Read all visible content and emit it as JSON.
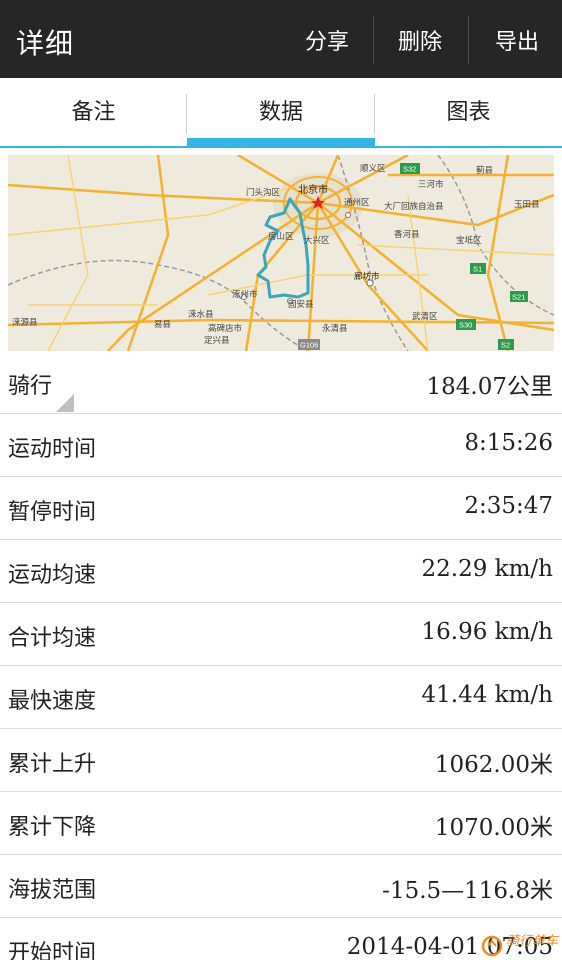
{
  "actionbar": {
    "title": "详细",
    "share_label": "分享",
    "delete_label": "删除",
    "export_label": "导出"
  },
  "tabs": {
    "items": [
      {
        "label": "备注",
        "active": false
      },
      {
        "label": "数据",
        "active": true
      },
      {
        "label": "图表",
        "active": false
      }
    ],
    "accent_color": "#33b5e5"
  },
  "map": {
    "labels": {
      "beijing": "北京市",
      "mentougou": "门头沟区",
      "fangshan": "房山区",
      "daxing": "大兴区",
      "tongzhou": "通州区",
      "sanhe": "三河市",
      "dachang": "大厂回族自治县",
      "xianghe": "香河县",
      "baodi": "宝坻区",
      "langfang": "廊坊市",
      "zhuozhou": "涿州市",
      "laishui": "涞水县",
      "gaobeidian": "高碑店市",
      "dingxing": "定兴县",
      "yixian": "易县",
      "laiyuan": "涞源县",
      "gu_an": "固安县",
      "yongqing": "永清县",
      "wuqing": "武清区",
      "jixian": "蓟县",
      "yutian": "玉田县",
      "shunyi": "顺义区",
      "road_g106": "G106",
      "road_s32": "S32",
      "road_s1": "S1",
      "road_s21": "S21",
      "road_s30": "S30",
      "road_s2": "S2"
    },
    "route_color": "#3aa6b9"
  },
  "stats": [
    {
      "label": "骑行",
      "value": "184.07公里"
    },
    {
      "label": "运动时间",
      "value": "8:15:26"
    },
    {
      "label": "暂停时间",
      "value": "2:35:47"
    },
    {
      "label": "运动均速",
      "value": "22.29 km/h"
    },
    {
      "label": "合计均速",
      "value": "16.96 km/h"
    },
    {
      "label": "最快速度",
      "value": "41.44 km/h"
    },
    {
      "label": "累计上升",
      "value": "1062.00米"
    },
    {
      "label": "累计下降",
      "value": "1070.00米"
    },
    {
      "label": "海拔范围",
      "value": "-15.5—116.8米"
    },
    {
      "label": "开始时间",
      "value": "2014-04-01 07:05"
    }
  ],
  "watermark": {
    "text": "骑行单车"
  }
}
